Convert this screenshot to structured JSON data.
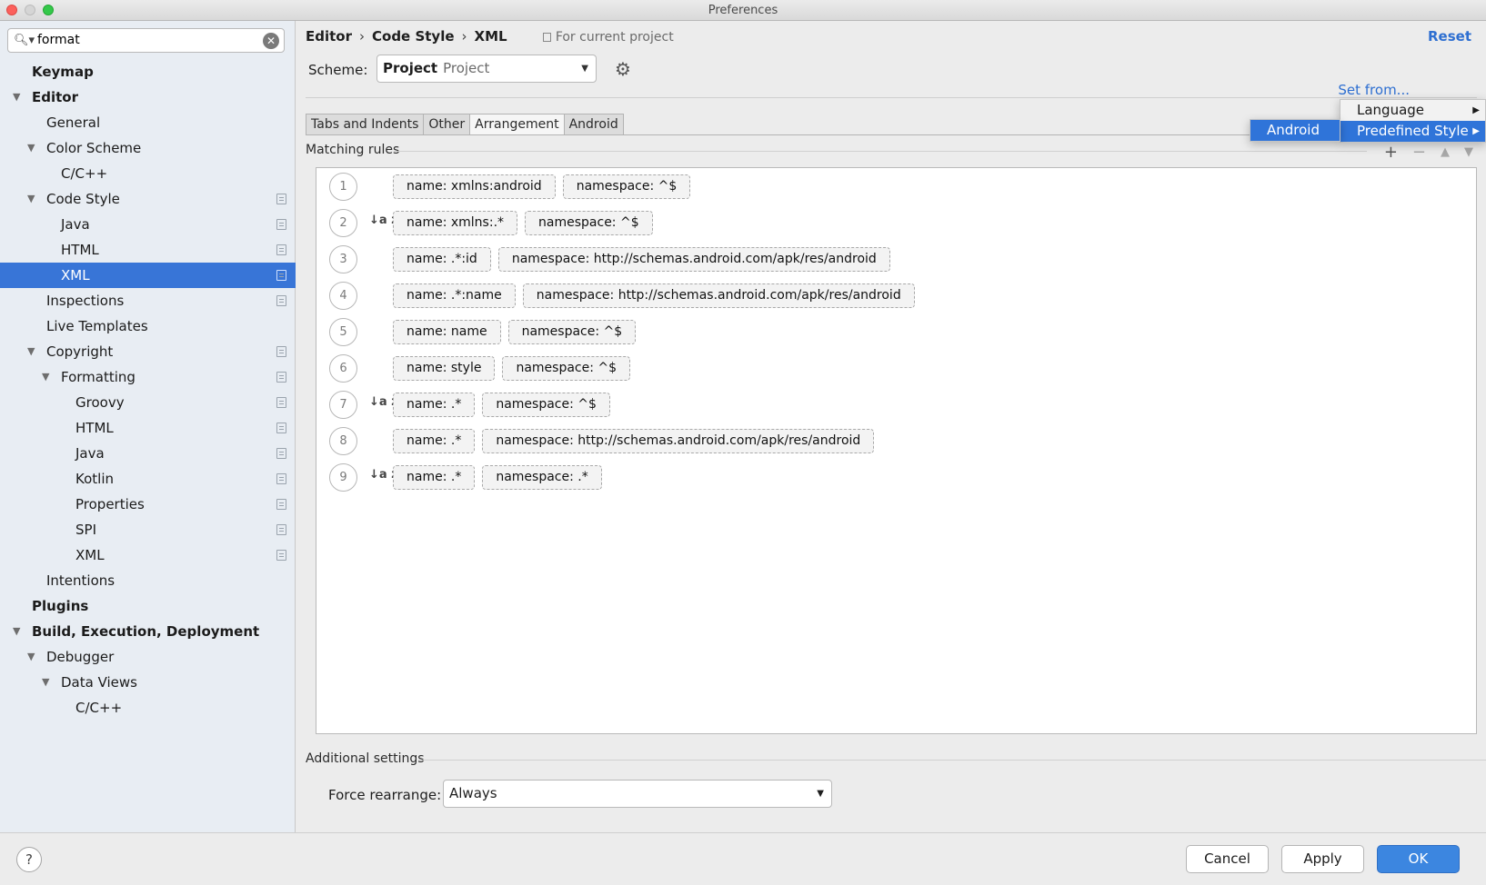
{
  "window": {
    "title": "Preferences"
  },
  "search": {
    "value": "format",
    "placeholder": ""
  },
  "tree": [
    {
      "label": "Keymap",
      "level": 0,
      "bold": true,
      "expander": "",
      "copy": false,
      "selected": false
    },
    {
      "label": "Editor",
      "level": 0,
      "bold": true,
      "expander": "open",
      "copy": false,
      "selected": false
    },
    {
      "label": "General",
      "level": 1,
      "bold": false,
      "expander": "",
      "copy": false,
      "selected": false
    },
    {
      "label": "Color Scheme",
      "level": 1,
      "bold": false,
      "expander": "open",
      "copy": false,
      "selected": false
    },
    {
      "label": "C/C++",
      "level": 2,
      "bold": false,
      "expander": "",
      "copy": false,
      "selected": false
    },
    {
      "label": "Code Style",
      "level": 1,
      "bold": false,
      "expander": "open",
      "copy": true,
      "selected": false
    },
    {
      "label": "Java",
      "level": 2,
      "bold": false,
      "expander": "",
      "copy": true,
      "selected": false
    },
    {
      "label": "HTML",
      "level": 2,
      "bold": false,
      "expander": "",
      "copy": true,
      "selected": false
    },
    {
      "label": "XML",
      "level": 2,
      "bold": false,
      "expander": "",
      "copy": true,
      "selected": true
    },
    {
      "label": "Inspections",
      "level": 1,
      "bold": false,
      "expander": "",
      "copy": true,
      "selected": false
    },
    {
      "label": "Live Templates",
      "level": 1,
      "bold": false,
      "expander": "",
      "copy": false,
      "selected": false
    },
    {
      "label": "Copyright",
      "level": 1,
      "bold": false,
      "expander": "open",
      "copy": true,
      "selected": false
    },
    {
      "label": "Formatting",
      "level": 2,
      "bold": false,
      "expander": "open",
      "copy": true,
      "selected": false
    },
    {
      "label": "Groovy",
      "level": 3,
      "bold": false,
      "expander": "",
      "copy": true,
      "selected": false
    },
    {
      "label": "HTML",
      "level": 3,
      "bold": false,
      "expander": "",
      "copy": true,
      "selected": false
    },
    {
      "label": "Java",
      "level": 3,
      "bold": false,
      "expander": "",
      "copy": true,
      "selected": false
    },
    {
      "label": "Kotlin",
      "level": 3,
      "bold": false,
      "expander": "",
      "copy": true,
      "selected": false
    },
    {
      "label": "Properties",
      "level": 3,
      "bold": false,
      "expander": "",
      "copy": true,
      "selected": false
    },
    {
      "label": "SPI",
      "level": 3,
      "bold": false,
      "expander": "",
      "copy": true,
      "selected": false
    },
    {
      "label": "XML",
      "level": 3,
      "bold": false,
      "expander": "",
      "copy": true,
      "selected": false
    },
    {
      "label": "Intentions",
      "level": 1,
      "bold": false,
      "expander": "",
      "copy": false,
      "selected": false
    },
    {
      "label": "Plugins",
      "level": 0,
      "bold": true,
      "expander": "",
      "copy": false,
      "selected": false
    },
    {
      "label": "Build, Execution, Deployment",
      "level": 0,
      "bold": true,
      "expander": "open",
      "copy": false,
      "selected": false
    },
    {
      "label": "Debugger",
      "level": 1,
      "bold": false,
      "expander": "open",
      "copy": false,
      "selected": false
    },
    {
      "label": "Data Views",
      "level": 2,
      "bold": false,
      "expander": "open",
      "copy": false,
      "selected": false
    },
    {
      "label": "C/C++",
      "level": 3,
      "bold": false,
      "expander": "",
      "copy": false,
      "selected": false
    }
  ],
  "breadcrumb": {
    "items": [
      "Editor",
      "Code Style",
      "XML"
    ],
    "sep": "›",
    "scope": "For current project"
  },
  "header": {
    "reset": "Reset"
  },
  "scheme": {
    "label": "Scheme:",
    "name": "Project",
    "type": "Project"
  },
  "set_from": "Set from...",
  "tabs": [
    {
      "label": "Tabs and Indents",
      "active": false
    },
    {
      "label": "Other",
      "active": false
    },
    {
      "label": "Arrangement",
      "active": true
    },
    {
      "label": "Android",
      "active": false
    }
  ],
  "matching_rules": {
    "title": "Matching rules",
    "buttons": {
      "add": "+",
      "remove": "−",
      "up": "▲",
      "down": "▼"
    },
    "rules": [
      {
        "num": "1",
        "sorted": false,
        "chips": [
          "name: xmlns:android",
          "namespace: ^$"
        ]
      },
      {
        "num": "2",
        "sorted": true,
        "chips": [
          "name: xmlns:.*",
          "namespace: ^$"
        ]
      },
      {
        "num": "3",
        "sorted": false,
        "chips": [
          "name: .*:id",
          "namespace: http://schemas.android.com/apk/res/android"
        ]
      },
      {
        "num": "4",
        "sorted": false,
        "chips": [
          "name: .*:name",
          "namespace: http://schemas.android.com/apk/res/android"
        ]
      },
      {
        "num": "5",
        "sorted": false,
        "chips": [
          "name: name",
          "namespace: ^$"
        ]
      },
      {
        "num": "6",
        "sorted": false,
        "chips": [
          "name: style",
          "namespace: ^$"
        ]
      },
      {
        "num": "7",
        "sorted": true,
        "chips": [
          "name: .*",
          "namespace: ^$"
        ]
      },
      {
        "num": "8",
        "sorted": false,
        "chips": [
          "name: .*",
          "namespace: http://schemas.android.com/apk/res/android"
        ]
      },
      {
        "num": "9",
        "sorted": true,
        "chips": [
          "name: .*",
          "namespace: .*"
        ]
      }
    ],
    "sort_glyph": "↓a z"
  },
  "additional": {
    "title": "Additional settings",
    "force_label": "Force rearrange:",
    "force_value": "Always"
  },
  "popup": {
    "main": [
      {
        "label": "Language",
        "highlighted": false
      },
      {
        "label": "Predefined Style",
        "highlighted": true
      }
    ],
    "sub": [
      {
        "label": "Android",
        "highlighted": true
      }
    ]
  },
  "footer": {
    "help": "?",
    "cancel": "Cancel",
    "apply": "Apply",
    "ok": "OK"
  },
  "colors": {
    "accent": "#3875d7",
    "link": "#2e6fd1",
    "primary_button": "#3c86e0"
  }
}
